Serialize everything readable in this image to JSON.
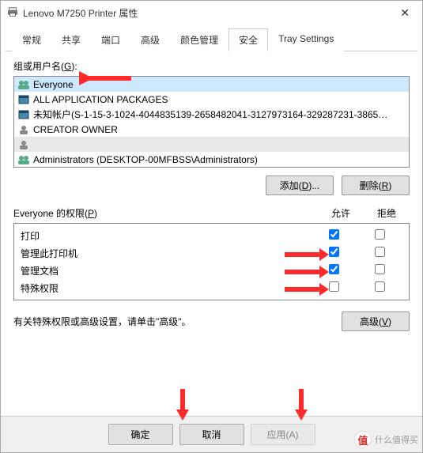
{
  "title": "Lenovo M7250 Printer 属性",
  "tabs": [
    "常规",
    "共享",
    "端口",
    "高级",
    "颜色管理",
    "安全",
    "Tray Settings"
  ],
  "activeTab": 5,
  "groupLabel_pre": "组或用户名(",
  "groupLabel_u": "G",
  "groupLabel_post": "):",
  "users": [
    {
      "name": "Everyone",
      "icon": "users"
    },
    {
      "name": "ALL APPLICATION PACKAGES",
      "icon": "pkg"
    },
    {
      "name": "未知帐户(S-1-15-3-1024-4044835139-2658482041-3127973164-329287231-3865…",
      "icon": "pkg"
    },
    {
      "name": "CREATOR OWNER",
      "icon": "user"
    },
    {
      "name": "",
      "icon": "user",
      "blur": true
    },
    {
      "name": "Administrators (DESKTOP-00MFBSS\\Administrators)",
      "icon": "users"
    }
  ],
  "addBtn_pre": "添加(",
  "addBtn_u": "D",
  "addBtn_post": ")...",
  "removeBtn_pre": "删除(",
  "removeBtn_u": "R",
  "removeBtn_post": ")",
  "permLabel_pre": "Everyone 的权限(",
  "permLabel_u": "P",
  "permLabel_post": ")",
  "col_allow": "允许",
  "col_deny": "拒绝",
  "perms": [
    {
      "name": "打印",
      "allow": true,
      "deny": false
    },
    {
      "name": "管理此打印机",
      "allow": true,
      "deny": false
    },
    {
      "name": "管理文档",
      "allow": true,
      "deny": false
    },
    {
      "name": "特殊权限",
      "allow": false,
      "deny": false
    }
  ],
  "advText": "有关特殊权限或高级设置，请单击\"高级\"。",
  "advBtn_pre": "高级(",
  "advBtn_u": "V",
  "advBtn_post": ")",
  "ok": "确定",
  "cancel": "取消",
  "apply": "应用(A)",
  "watermark": "什么值得买"
}
